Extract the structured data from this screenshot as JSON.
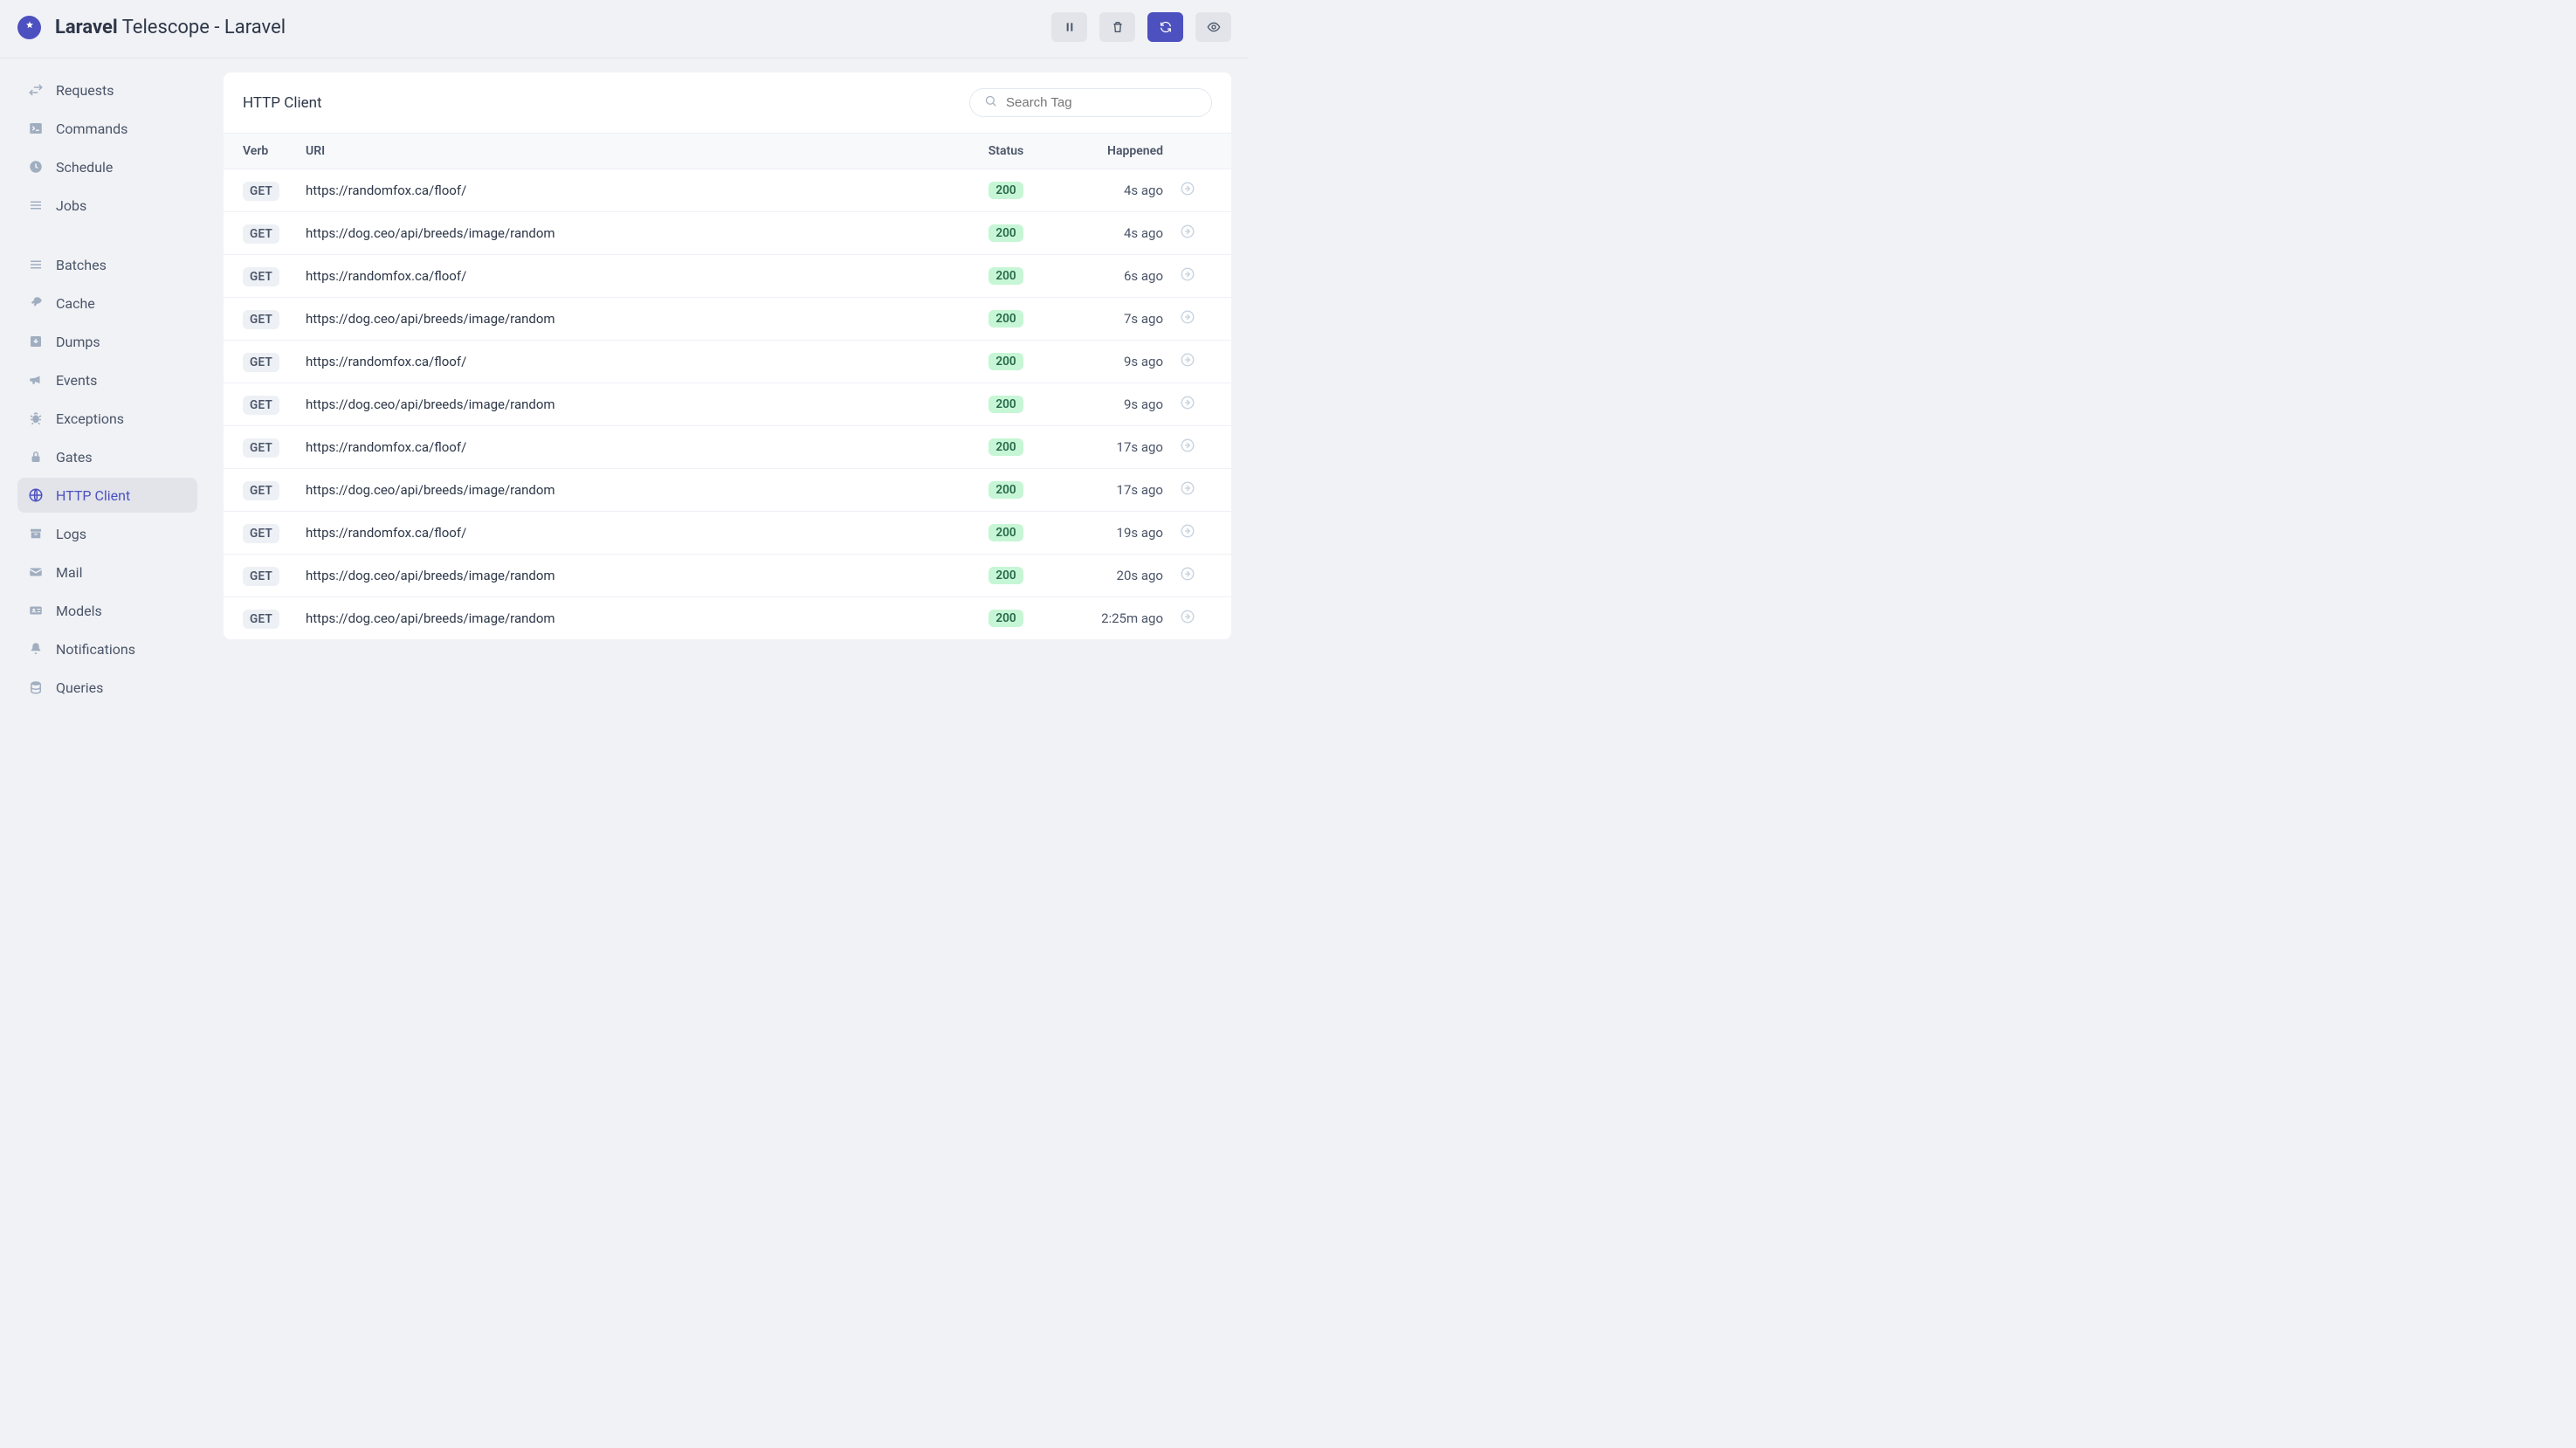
{
  "header": {
    "title_bold": "Laravel",
    "title_rest": " Telescope - Laravel"
  },
  "toolbar": {
    "pause": "pause",
    "clear": "clear",
    "refresh": "refresh",
    "toggle": "toggle-view"
  },
  "sidebar": {
    "groups": [
      {
        "items": [
          {
            "id": "requests",
            "label": "Requests",
            "icon": "swap"
          },
          {
            "id": "commands",
            "label": "Commands",
            "icon": "terminal"
          },
          {
            "id": "schedule",
            "label": "Schedule",
            "icon": "clock"
          },
          {
            "id": "jobs",
            "label": "Jobs",
            "icon": "list"
          }
        ]
      },
      {
        "items": [
          {
            "id": "batches",
            "label": "Batches",
            "icon": "stack"
          },
          {
            "id": "cache",
            "label": "Cache",
            "icon": "rocket"
          },
          {
            "id": "dumps",
            "label": "Dumps",
            "icon": "download"
          },
          {
            "id": "events",
            "label": "Events",
            "icon": "bullhorn"
          },
          {
            "id": "exceptions",
            "label": "Exceptions",
            "icon": "bug"
          },
          {
            "id": "gates",
            "label": "Gates",
            "icon": "lock"
          },
          {
            "id": "httpclient",
            "label": "HTTP Client",
            "icon": "globe",
            "active": true
          },
          {
            "id": "logs",
            "label": "Logs",
            "icon": "archive"
          },
          {
            "id": "mail",
            "label": "Mail",
            "icon": "mail"
          },
          {
            "id": "models",
            "label": "Models",
            "icon": "idcard"
          },
          {
            "id": "notifications",
            "label": "Notifications",
            "icon": "bell"
          },
          {
            "id": "queries",
            "label": "Queries",
            "icon": "db"
          }
        ]
      }
    ]
  },
  "main": {
    "title": "HTTP Client",
    "search_placeholder": "Search Tag",
    "columns": {
      "verb": "Verb",
      "uri": "URI",
      "status": "Status",
      "happened": "Happened"
    },
    "rows": [
      {
        "verb": "GET",
        "uri": "https://randomfox.ca/floof/",
        "status": "200",
        "happened": "4s ago"
      },
      {
        "verb": "GET",
        "uri": "https://dog.ceo/api/breeds/image/random",
        "status": "200",
        "happened": "4s ago"
      },
      {
        "verb": "GET",
        "uri": "https://randomfox.ca/floof/",
        "status": "200",
        "happened": "6s ago"
      },
      {
        "verb": "GET",
        "uri": "https://dog.ceo/api/breeds/image/random",
        "status": "200",
        "happened": "7s ago"
      },
      {
        "verb": "GET",
        "uri": "https://randomfox.ca/floof/",
        "status": "200",
        "happened": "9s ago"
      },
      {
        "verb": "GET",
        "uri": "https://dog.ceo/api/breeds/image/random",
        "status": "200",
        "happened": "9s ago"
      },
      {
        "verb": "GET",
        "uri": "https://randomfox.ca/floof/",
        "status": "200",
        "happened": "17s ago"
      },
      {
        "verb": "GET",
        "uri": "https://dog.ceo/api/breeds/image/random",
        "status": "200",
        "happened": "17s ago"
      },
      {
        "verb": "GET",
        "uri": "https://randomfox.ca/floof/",
        "status": "200",
        "happened": "19s ago"
      },
      {
        "verb": "GET",
        "uri": "https://dog.ceo/api/breeds/image/random",
        "status": "200",
        "happened": "20s ago"
      },
      {
        "verb": "GET",
        "uri": "https://dog.ceo/api/breeds/image/random",
        "status": "200",
        "happened": "2:25m ago"
      }
    ]
  }
}
